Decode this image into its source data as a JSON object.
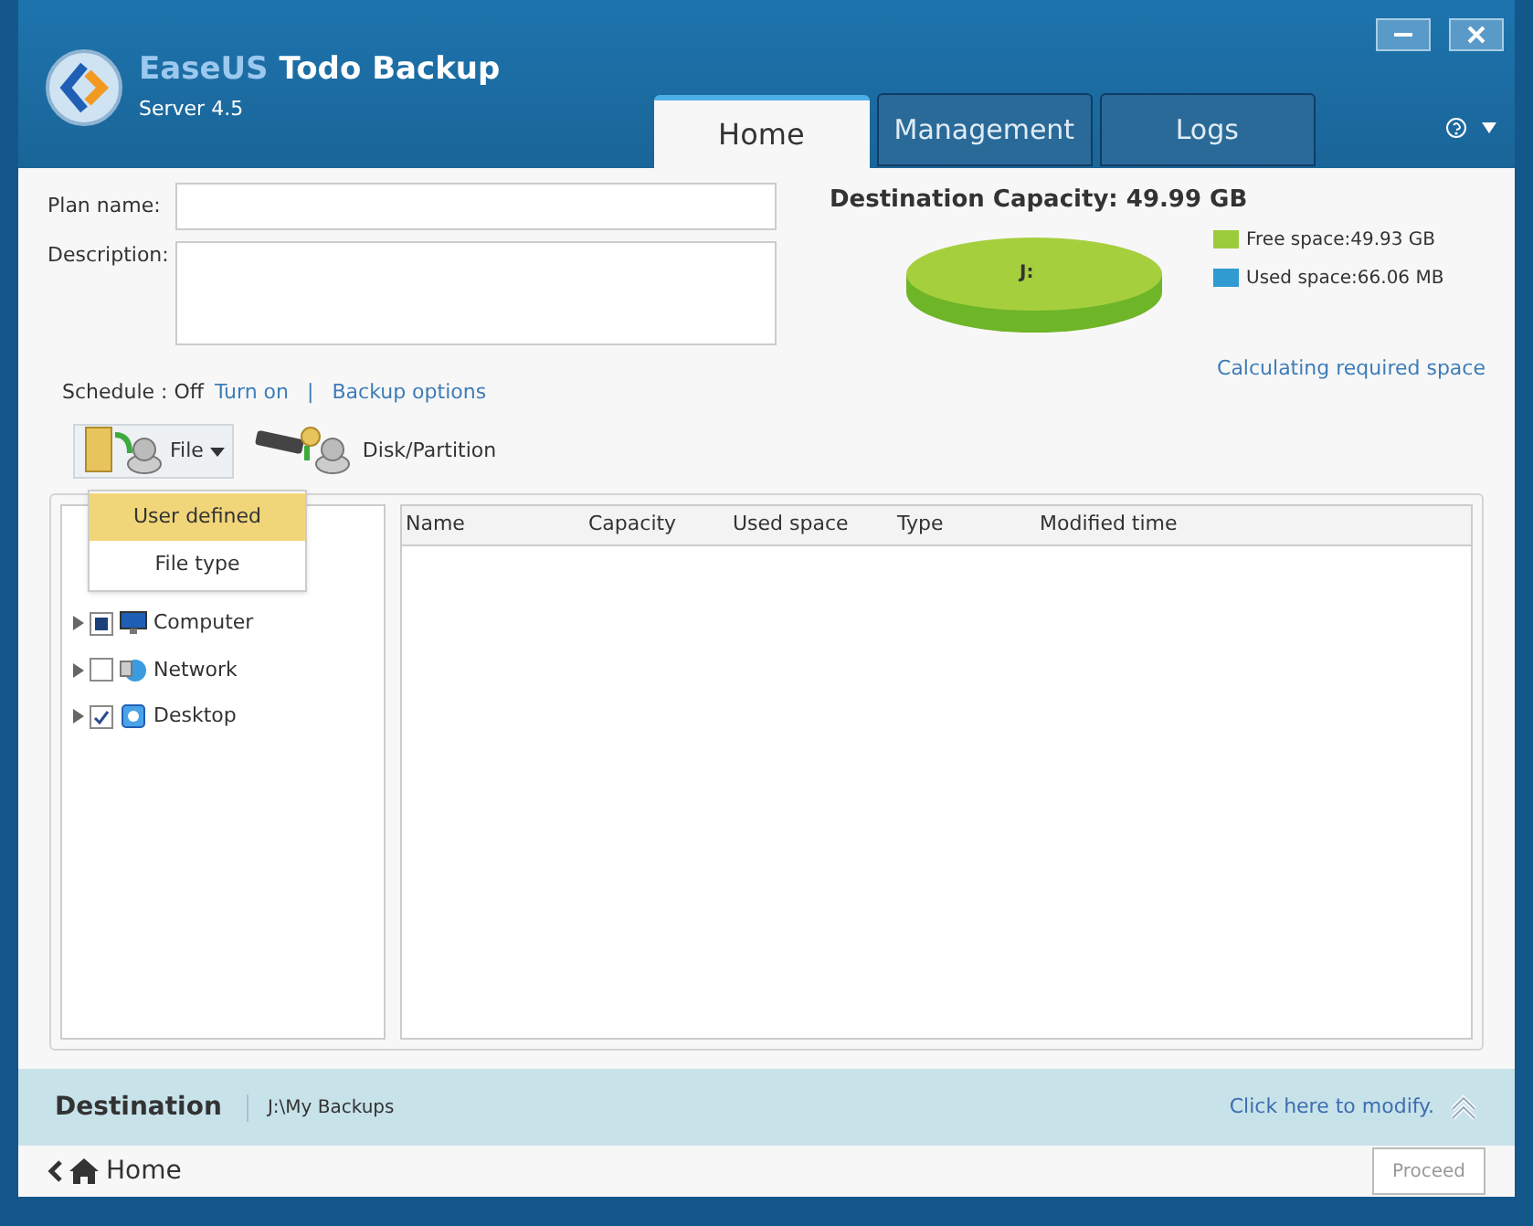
{
  "app": {
    "brand_part1": "EaseUS",
    "brand_part2": "Todo Backup",
    "edition": "Server 4.5"
  },
  "tabs": [
    {
      "label": "Home",
      "selected": true
    },
    {
      "label": "Management",
      "selected": false
    },
    {
      "label": "Logs",
      "selected": false
    }
  ],
  "form": {
    "plan_name_label": "Plan name:",
    "description_label": "Description:"
  },
  "schedule": {
    "label": "Schedule : Off",
    "turn_on": "Turn on",
    "separator": "|",
    "backup_options": "Backup options"
  },
  "destination_capacity": {
    "title": "Destination Capacity: 49.99 GB",
    "drive": "J:",
    "legend": [
      {
        "label": "Free space:49.93 GB",
        "color": "#9ccc3c"
      },
      {
        "label": "Used space:66.06 MB",
        "color": "#2f9bd0"
      }
    ],
    "calculating": "Calculating required space"
  },
  "toolbar": [
    {
      "label": "File",
      "kind": "file"
    },
    {
      "label": "Disk/Partition",
      "kind": "disk"
    }
  ],
  "file_menu": [
    {
      "label": "User defined",
      "selected": true
    },
    {
      "label": "File type",
      "selected": false
    }
  ],
  "tree": [
    {
      "label": "Computer",
      "checked": false,
      "partial": true,
      "kind": "computer"
    },
    {
      "label": "Network",
      "checked": false,
      "partial": false,
      "kind": "network"
    },
    {
      "label": "Desktop",
      "checked": true,
      "partial": false,
      "kind": "desktop"
    }
  ],
  "table": {
    "columns": [
      "Name",
      "Capacity",
      "Used space",
      "Type",
      "Modified time"
    ]
  },
  "destination": {
    "label": "Destination",
    "path": "J:\\My Backups",
    "modify": "Click here to modify."
  },
  "footer": {
    "home": "Home",
    "proceed": "Proceed"
  }
}
